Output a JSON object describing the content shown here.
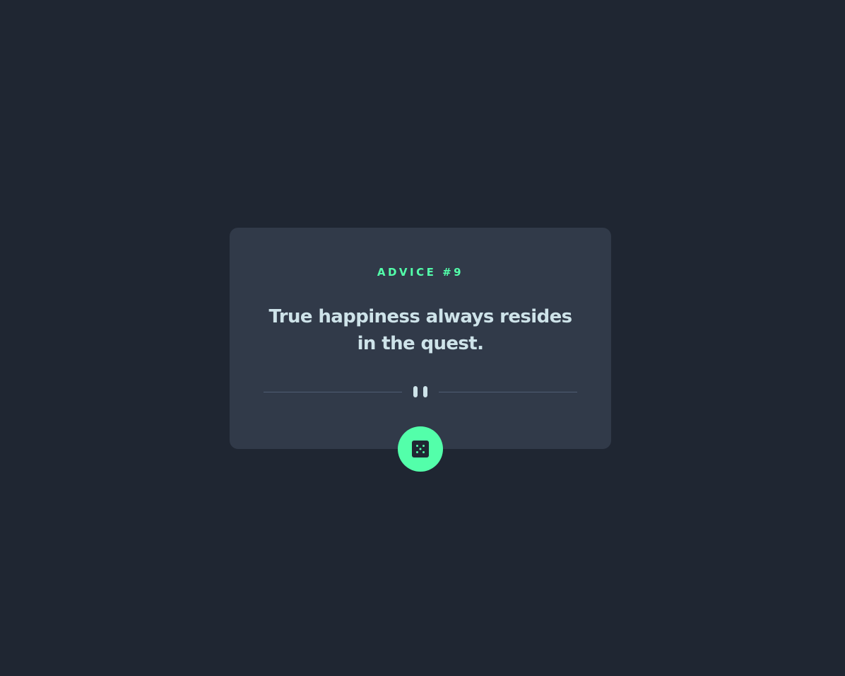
{
  "advice": {
    "id_label": "ADVICE #9",
    "text": "True happiness always resides in the quest."
  },
  "controls": {
    "new_advice_icon": "dice-icon",
    "divider_icon": "pause-icon"
  },
  "colors": {
    "background": "#1f2632",
    "card": "#313a49",
    "accent": "#53ffaa",
    "text": "#cee3e9",
    "divider": "#4f5d74"
  }
}
